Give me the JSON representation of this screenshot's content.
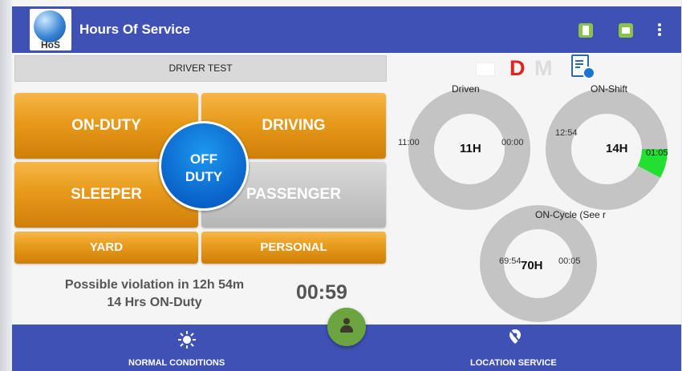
{
  "app": {
    "title": "Hours Of Service",
    "logo_text": "HoS"
  },
  "appbar": {
    "icons": [
      "device-icon",
      "truck-icon",
      "more-vert-icon"
    ],
    "color": "#3f51b5"
  },
  "driver": {
    "name": "DRIVER TEST"
  },
  "duty_buttons": {
    "on_duty": "ON-DUTY",
    "driving": "DRIVING",
    "off_duty_line1": "OFF",
    "off_duty_line2": "DUTY",
    "sleeper": "SLEEPER",
    "passenger": "PASSENGER",
    "yard": "YARD",
    "personal": "PERSONAL"
  },
  "violation": {
    "line1": "Possible violation in 12h 54m",
    "line2": "14 Hrs ON-Duty"
  },
  "timer": "00:59",
  "status_indicators": {
    "d_label": "D",
    "m_label": "M",
    "d_color": "#e52020",
    "m_color": "#dcdcdc"
  },
  "gauges": {
    "driven": {
      "label": "Driven",
      "center": "11H",
      "left": "11:00",
      "right": "00:00",
      "fraction_used": 0.0
    },
    "onshift": {
      "label": "ON-Shift",
      "center": "14H",
      "left": "12:54",
      "right": "01:05",
      "fraction_used": 0.078
    },
    "oncycle": {
      "label": "ON-Cycle (See r",
      "center": "70H",
      "left": "69:54",
      "right": "00:05",
      "fraction_used": 0.001
    }
  },
  "bottom_nav": {
    "left_label": "NORMAL CONDITIONS",
    "right_label": "LOCATION SERVICE"
  },
  "colors": {
    "accent_green": "#22e032",
    "orange": "#e79a1a",
    "blue_button": "#0a63c9"
  }
}
